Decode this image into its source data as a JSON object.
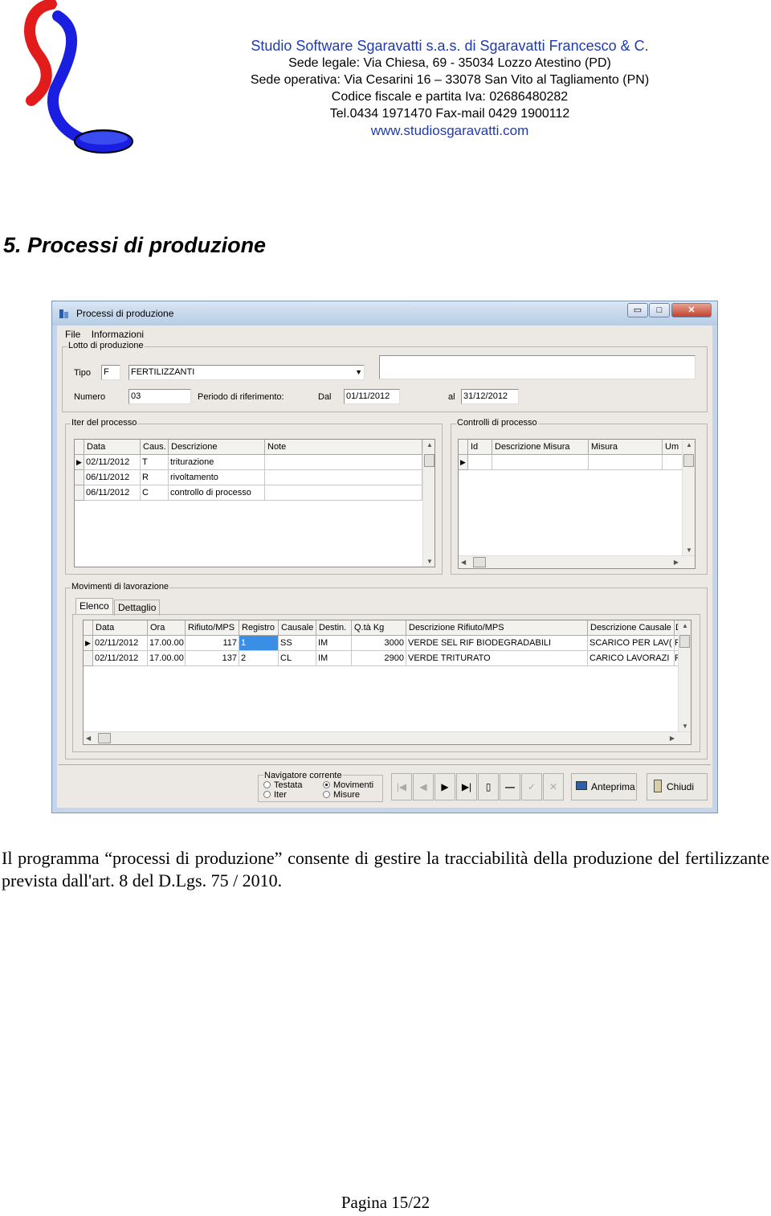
{
  "company": {
    "name": "Studio Software Sgaravatti s.a.s. di Sgaravatti Francesco & C.",
    "legal": "Sede legale: Via Chiesa, 69 - 35034 Lozzo Atestino (PD)",
    "operative": "Sede operativa: Via Cesarini 16 – 33078 San Vito al Tagliamento (PN)",
    "tax": "Codice fiscale e partita Iva: 02686480282",
    "phone": "Tel.0434 1971470 Fax-mail 0429 1900112",
    "web": "www.studiosgaravatti.com"
  },
  "section_title": "5. Processi di produzione",
  "window": {
    "title": "Processi di produzione",
    "menu": [
      "File",
      "Informazioni"
    ],
    "lotto": {
      "legend": "Lotto di produzione",
      "tipo_label": "Tipo",
      "tipo_code": "F",
      "tipo_name": "FERTILIZZANTI",
      "numero_label": "Numero",
      "numero": "03",
      "periodo_label": "Periodo di riferimento:",
      "dal_label": "Dal",
      "dal": "01/11/2012",
      "al_label": "al",
      "al": "31/12/2012"
    },
    "iter": {
      "legend": "Iter del processo",
      "columns": [
        "Data",
        "Caus.",
        "Descrizione",
        "Note"
      ],
      "rows": [
        [
          "02/11/2012",
          "T",
          "triturazione",
          ""
        ],
        [
          "06/11/2012",
          "R",
          "rivoltamento",
          ""
        ],
        [
          "06/11/2012",
          "C",
          "controllo di processo",
          ""
        ]
      ]
    },
    "controlli": {
      "legend": "Controlli di processo",
      "columns": [
        "Id",
        "Descrizione Misura",
        "Misura",
        "Um"
      ]
    },
    "movimenti": {
      "legend": "Movimenti di lavorazione",
      "tabs": [
        "Elenco",
        "Dettaglio"
      ],
      "columns": [
        "Data",
        "Ora",
        "Rifiuto/MPS",
        "Registro",
        "Causale",
        "Destin.",
        "Q.tà Kg",
        "Descrizione Rifiuto/MPS",
        "Descrizione Causale",
        "D"
      ],
      "rows": [
        [
          "02/11/2012",
          "17.00.00",
          "117",
          "1",
          "SS",
          "IM",
          "3000",
          "VERDE SEL RIF BIODEGRADABILI",
          "SCARICO PER LAV(",
          "R"
        ],
        [
          "02/11/2012",
          "17.00.00",
          "137",
          "2",
          "CL",
          "IM",
          "2900",
          "VERDE TRITURATO",
          "CARICO LAVORAZI",
          "R"
        ]
      ]
    },
    "navigator": {
      "legend": "Navigatore corrente",
      "options": [
        "Testata",
        "Movimenti",
        "Iter",
        "Misure"
      ],
      "selected": "Movimenti"
    },
    "buttons": {
      "preview": "Anteprima",
      "close": "Chiudi"
    }
  },
  "paragraph": "Il programma “processi di produzione” consente di gestire la tracciabilità della produzione del fertilizzante prevista dall'art. 8 del D.Lgs. 75 / 2010.",
  "footer": "Pagina 15/22"
}
